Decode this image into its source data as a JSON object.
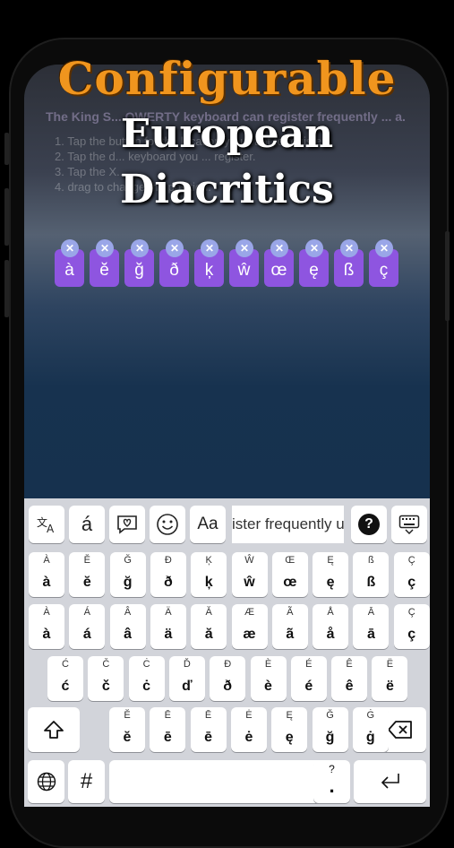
{
  "headline": {
    "line1": "Configurable",
    "line2": "European",
    "line3": "Diacritics"
  },
  "instructions": {
    "lead": "The King S... QWERTY keyboard can register frequently ... a.",
    "steps": [
      "1. Tap the button for the location you want to register.",
      "2. Tap the d... keyboard you ... register.",
      "3. Tap the X...",
      "4. drag to change the position."
    ]
  },
  "registered_keys": [
    "à",
    "ĕ",
    "ğ",
    "ð",
    "ķ",
    "ŵ",
    "œ",
    "ę",
    "ß",
    "ç"
  ],
  "toolbar": {
    "translate_icon": "translate-icon",
    "accent_label": "á",
    "favorite_icon": "heart-message-icon",
    "emoji_icon": "smiley-icon",
    "case_label": "Aa",
    "suggestion_text": "ister frequently u",
    "help_label": "?",
    "keyboard_hide_icon": "keyboard-hide-icon"
  },
  "rows": [
    [
      {
        "sec": "À",
        "pri": "à"
      },
      {
        "sec": "Ĕ",
        "pri": "ĕ"
      },
      {
        "sec": "Ğ",
        "pri": "ğ"
      },
      {
        "sec": "Ð",
        "pri": "ð"
      },
      {
        "sec": "Ķ",
        "pri": "ķ"
      },
      {
        "sec": "Ŵ",
        "pri": "ŵ"
      },
      {
        "sec": "Œ",
        "pri": "œ"
      },
      {
        "sec": "Ę",
        "pri": "ę"
      },
      {
        "sec": "ß",
        "pri": "ß"
      },
      {
        "sec": "Ç",
        "pri": "ç"
      }
    ],
    [
      {
        "sec": "À",
        "pri": "à"
      },
      {
        "sec": "Á",
        "pri": "á"
      },
      {
        "sec": "Â",
        "pri": "â"
      },
      {
        "sec": "Ä",
        "pri": "ä"
      },
      {
        "sec": "Ă",
        "pri": "ă"
      },
      {
        "sec": "Æ",
        "pri": "æ"
      },
      {
        "sec": "Ã",
        "pri": "ã"
      },
      {
        "sec": "Å",
        "pri": "å"
      },
      {
        "sec": "Ā",
        "pri": "ā"
      },
      {
        "sec": "Ç",
        "pri": "ç"
      }
    ],
    [
      {
        "sec": "Ć",
        "pri": "ć"
      },
      {
        "sec": "Č",
        "pri": "č"
      },
      {
        "sec": "Ċ",
        "pri": "ċ"
      },
      {
        "sec": "Ď",
        "pri": "ď"
      },
      {
        "sec": "Ð",
        "pri": "ð"
      },
      {
        "sec": "È",
        "pri": "è"
      },
      {
        "sec": "É",
        "pri": "é"
      },
      {
        "sec": "Ê",
        "pri": "ê"
      },
      {
        "sec": "Ë",
        "pri": "ë"
      }
    ],
    [
      {
        "sec": "Ĕ",
        "pri": "ĕ"
      },
      {
        "sec": "Ē",
        "pri": "ē"
      },
      {
        "sec": "Ē",
        "pri": "ē"
      },
      {
        "sec": "Ė",
        "pri": "ė"
      },
      {
        "sec": "Ę",
        "pri": "ę"
      },
      {
        "sec": "Ğ",
        "pri": "ğ"
      },
      {
        "sec": "Ġ",
        "pri": "ġ"
      }
    ]
  ],
  "bottom_row": {
    "globe_icon": "globe-icon",
    "hash_label": "#",
    "punct_top": "?",
    "punct_bottom": ".",
    "return_icon": "return-icon",
    "shift_icon": "shift-icon",
    "backspace_icon": "backspace-icon"
  },
  "colors": {
    "accent_orange": "#f0951e",
    "registered_key_purple": "#8e55e0",
    "keyboard_bg": "#d2d4da"
  }
}
